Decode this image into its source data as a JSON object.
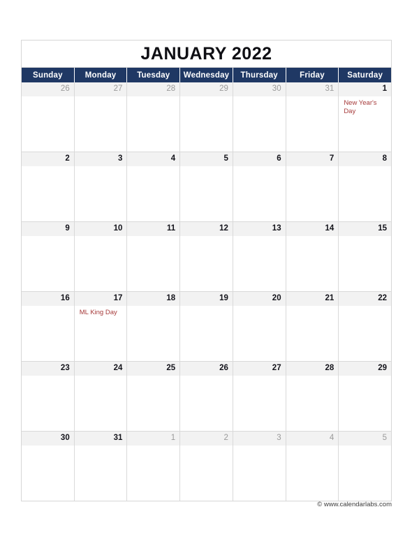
{
  "calendar": {
    "title": "JANUARY 2022",
    "weekdays": [
      "Sunday",
      "Monday",
      "Tuesday",
      "Wednesday",
      "Thursday",
      "Friday",
      "Saturday"
    ],
    "colors": {
      "header_bg": "#1F3864",
      "header_text": "#FFFFFF",
      "date_band_bg": "#F2F2F2",
      "in_month_date": "#13131A",
      "out_month_date": "#9A9A9A",
      "event_text": "#A63A3A",
      "grid_line": "#D9D9D9"
    },
    "weeks": [
      [
        {
          "date": "26",
          "in_month": false,
          "event": ""
        },
        {
          "date": "27",
          "in_month": false,
          "event": ""
        },
        {
          "date": "28",
          "in_month": false,
          "event": ""
        },
        {
          "date": "29",
          "in_month": false,
          "event": ""
        },
        {
          "date": "30",
          "in_month": false,
          "event": ""
        },
        {
          "date": "31",
          "in_month": false,
          "event": ""
        },
        {
          "date": "1",
          "in_month": true,
          "event": "New Year's Day"
        }
      ],
      [
        {
          "date": "2",
          "in_month": true,
          "event": ""
        },
        {
          "date": "3",
          "in_month": true,
          "event": ""
        },
        {
          "date": "4",
          "in_month": true,
          "event": ""
        },
        {
          "date": "5",
          "in_month": true,
          "event": ""
        },
        {
          "date": "6",
          "in_month": true,
          "event": ""
        },
        {
          "date": "7",
          "in_month": true,
          "event": ""
        },
        {
          "date": "8",
          "in_month": true,
          "event": ""
        }
      ],
      [
        {
          "date": "9",
          "in_month": true,
          "event": ""
        },
        {
          "date": "10",
          "in_month": true,
          "event": ""
        },
        {
          "date": "11",
          "in_month": true,
          "event": ""
        },
        {
          "date": "12",
          "in_month": true,
          "event": ""
        },
        {
          "date": "13",
          "in_month": true,
          "event": ""
        },
        {
          "date": "14",
          "in_month": true,
          "event": ""
        },
        {
          "date": "15",
          "in_month": true,
          "event": ""
        }
      ],
      [
        {
          "date": "16",
          "in_month": true,
          "event": ""
        },
        {
          "date": "17",
          "in_month": true,
          "event": "ML King Day"
        },
        {
          "date": "18",
          "in_month": true,
          "event": ""
        },
        {
          "date": "19",
          "in_month": true,
          "event": ""
        },
        {
          "date": "20",
          "in_month": true,
          "event": ""
        },
        {
          "date": "21",
          "in_month": true,
          "event": ""
        },
        {
          "date": "22",
          "in_month": true,
          "event": ""
        }
      ],
      [
        {
          "date": "23",
          "in_month": true,
          "event": ""
        },
        {
          "date": "24",
          "in_month": true,
          "event": ""
        },
        {
          "date": "25",
          "in_month": true,
          "event": ""
        },
        {
          "date": "26",
          "in_month": true,
          "event": ""
        },
        {
          "date": "27",
          "in_month": true,
          "event": ""
        },
        {
          "date": "28",
          "in_month": true,
          "event": ""
        },
        {
          "date": "29",
          "in_month": true,
          "event": ""
        }
      ],
      [
        {
          "date": "30",
          "in_month": true,
          "event": ""
        },
        {
          "date": "31",
          "in_month": true,
          "event": ""
        },
        {
          "date": "1",
          "in_month": false,
          "event": ""
        },
        {
          "date": "2",
          "in_month": false,
          "event": ""
        },
        {
          "date": "3",
          "in_month": false,
          "event": ""
        },
        {
          "date": "4",
          "in_month": false,
          "event": ""
        },
        {
          "date": "5",
          "in_month": false,
          "event": ""
        }
      ]
    ]
  },
  "footer": {
    "credit": "© www.calendarlabs.com"
  }
}
